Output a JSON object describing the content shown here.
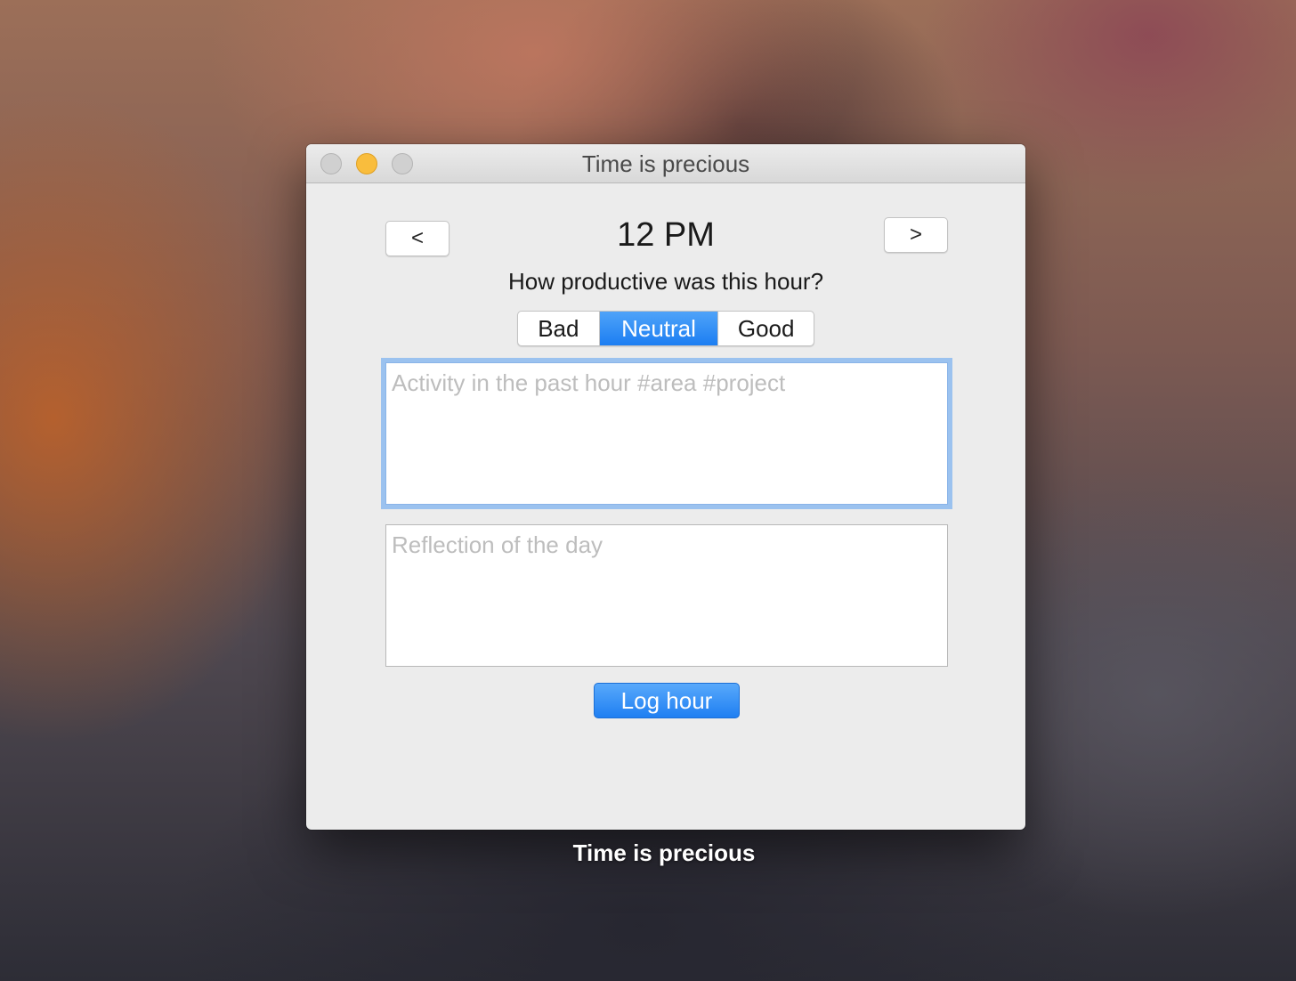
{
  "window": {
    "title": "Time is precious",
    "caption": "Time is precious"
  },
  "hour_nav": {
    "prev_label": "<",
    "next_label": ">",
    "current_hour": "12 PM"
  },
  "productivity": {
    "question": "How productive was this hour?",
    "options": [
      "Bad",
      "Neutral",
      "Good"
    ],
    "selected": "Neutral"
  },
  "activity": {
    "value": "",
    "placeholder": "Activity in the past hour #area #project"
  },
  "reflection": {
    "value": "",
    "placeholder": "Reflection of the day"
  },
  "actions": {
    "log_label": "Log hour"
  },
  "colors": {
    "accent": "#1c7ef2",
    "focus_ring": "#9bc2ef",
    "minimize_button": "#f9bd3d"
  }
}
